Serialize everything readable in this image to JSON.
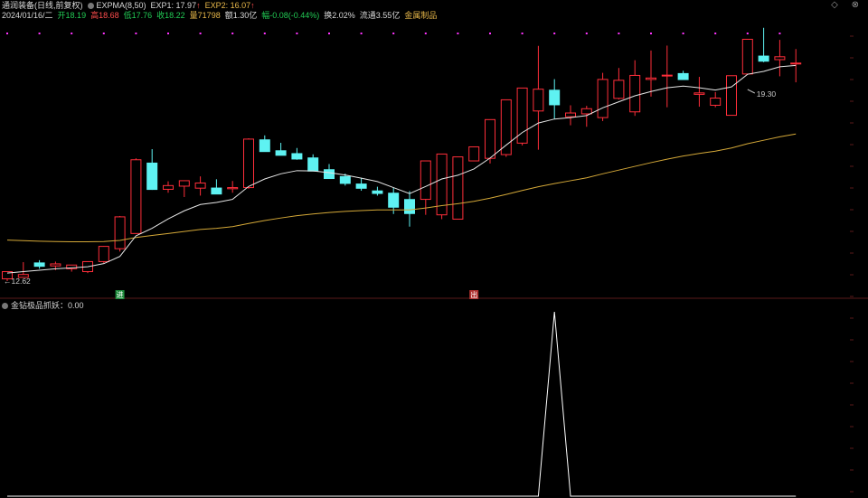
{
  "header": {
    "title": "通润装备(日线,前复权)",
    "indicator_name": "EXPMA(8,50)",
    "exp1": "EXP1: 17.97",
    "exp2": "EXP2: 16.07",
    "up_arrow": "↑",
    "date": "2024/01/16/二",
    "open": "开18.19",
    "high": "高18.68",
    "low": "低17.76",
    "close": "收18.22",
    "volume": "量71798",
    "amount": "额1.30亿",
    "change": "幅-0.08(-0.44%)",
    "turnover": "换2.02%",
    "float_cap": "流通3.55亿",
    "sector": "金属制品"
  },
  "window_controls": "◇ ⊗",
  "indicator_panel": {
    "label": "金钻极品抓妖：0.00"
  },
  "annotations": {
    "high_label": "19.30",
    "low_label": "←12.62",
    "buy_tag": "进",
    "sell_tag": "出"
  },
  "colors": {
    "up": "#ff2e3a",
    "down": "#5ef2f2",
    "exp1": "#e6e6e6",
    "exp2": "#d4a838",
    "signal": "#ffffff",
    "dot": "#ff33ff"
  },
  "chart_data": {
    "type": "candlestick",
    "x": [
      "1",
      "2",
      "3",
      "4",
      "5",
      "6",
      "7",
      "8",
      "9",
      "10",
      "11",
      "12",
      "13",
      "14",
      "15",
      "16",
      "17",
      "18",
      "19",
      "20",
      "21",
      "22",
      "23",
      "24",
      "25",
      "26",
      "27",
      "28",
      "29",
      "30",
      "31",
      "32",
      "33",
      "34",
      "35",
      "36",
      "37",
      "38",
      "39",
      "40",
      "41",
      "42",
      "43",
      "44",
      "45",
      "46",
      "47",
      "48",
      "49",
      "50"
    ],
    "open": [
      12.7,
      12.75,
      13.27,
      13.15,
      13.05,
      12.95,
      13.3,
      13.75,
      14.28,
      16.75,
      15.82,
      15.93,
      15.86,
      15.88,
      15.84,
      15.88,
      17.56,
      17.18,
      17.08,
      16.93,
      16.52,
      16.28,
      16.02,
      15.78,
      15.7,
      15.48,
      15.47,
      14.93,
      14.78,
      16.81,
      16.9,
      17.03,
      17.43,
      18.55,
      19.29,
      18.35,
      18.45,
      18.32,
      18.99,
      18.52,
      19.65,
      19.79,
      19.87,
      19.13,
      18.75,
      18.4,
      19.84,
      20.48,
      20.34,
      20.21
    ],
    "high": [
      12.92,
      13.28,
      13.35,
      13.3,
      13.12,
      13.29,
      13.84,
      14.89,
      16.9,
      17.22,
      16.1,
      16.1,
      16.27,
      16.17,
      16.11,
      17.6,
      17.7,
      17.44,
      17.26,
      17.04,
      16.7,
      16.37,
      16.22,
      15.91,
      15.88,
      15.76,
      15.6,
      15.15,
      16.78,
      17.25,
      17.1,
      18.0,
      18.8,
      20.82,
      19.66,
      18.75,
      18.73,
      19.88,
      20.05,
      20.32,
      20.66,
      20.83,
      19.95,
      19.74,
      19.21,
      19.1,
      20.9,
      21.45,
      21.03,
      20.71
    ],
    "low": [
      12.62,
      12.75,
      13.05,
      13.0,
      12.95,
      12.9,
      13.25,
      13.65,
      14.28,
      15.8,
      15.7,
      15.55,
      15.6,
      15.65,
      15.7,
      15.84,
      17.15,
      17.02,
      16.85,
      16.48,
      16.2,
      15.95,
      15.77,
      15.6,
      14.96,
      14.52,
      14.93,
      14.78,
      14.78,
      16.81,
      16.72,
      16.95,
      17.35,
      17.2,
      18.26,
      18.05,
      18.0,
      18.2,
      18.95,
      18.38,
      19.05,
      18.68,
      19.72,
      18.7,
      18.68,
      18.4,
      19.82,
      20.25,
      19.76,
      19.55
    ],
    "close": [
      12.95,
      12.85,
      13.12,
      13.22,
      13.18,
      13.3,
      13.83,
      14.86,
      16.85,
      15.8,
      15.95,
      16.12,
      16.04,
      15.64,
      15.88,
      17.57,
      17.12,
      16.99,
      16.86,
      16.44,
      16.18,
      16.01,
      15.84,
      15.66,
      15.18,
      14.96,
      16.81,
      17.05,
      16.95,
      17.3,
      18.25,
      18.94,
      19.35,
      19.31,
      18.75,
      18.48,
      18.63,
      19.65,
      19.62,
      19.79,
      19.7,
      19.8,
      19.63,
      19.18,
      19.0,
      19.78,
      21.05,
      20.27,
      20.44,
      20.22
    ],
    "exp1": [
      12.9,
      12.95,
      13.0,
      13.05,
      13.08,
      13.12,
      13.23,
      13.48,
      14.2,
      14.46,
      14.79,
      15.07,
      15.29,
      15.36,
      15.47,
      15.92,
      16.18,
      16.36,
      16.47,
      16.46,
      16.4,
      16.32,
      16.21,
      16.09,
      15.88,
      15.67,
      15.92,
      16.18,
      16.31,
      16.53,
      16.91,
      17.36,
      17.8,
      18.13,
      18.27,
      18.32,
      18.39,
      18.66,
      18.87,
      19.08,
      19.23,
      19.36,
      19.42,
      19.36,
      19.28,
      19.39,
      19.83,
      19.93,
      20.09,
      20.14
    ],
    "exp2": [
      14.05,
      14.03,
      14.01,
      14.0,
      13.99,
      13.99,
      14.0,
      14.04,
      14.14,
      14.21,
      14.28,
      14.35,
      14.42,
      14.46,
      14.52,
      14.63,
      14.73,
      14.82,
      14.9,
      14.96,
      15.01,
      15.05,
      15.08,
      15.1,
      15.1,
      15.1,
      15.17,
      15.25,
      15.32,
      15.4,
      15.51,
      15.64,
      15.78,
      15.91,
      16.02,
      16.12,
      16.22,
      16.36,
      16.49,
      16.62,
      16.75,
      16.87,
      16.98,
      17.07,
      17.15,
      17.26,
      17.41,
      17.53,
      17.65,
      17.75
    ],
    "signal": [
      0,
      0,
      0,
      0,
      0,
      0,
      0,
      0,
      0,
      0,
      0,
      0,
      0,
      0,
      0,
      0,
      0,
      0,
      0,
      0,
      0,
      0,
      0,
      0,
      0,
      0,
      0,
      0,
      0,
      0,
      0,
      0,
      0,
      0,
      1,
      0,
      0,
      0,
      0,
      0,
      0,
      0,
      0,
      0,
      0,
      0,
      0,
      0,
      0,
      0
    ],
    "ylim": [
      12.4,
      21.6
    ],
    "signal_ylim": [
      0,
      1
    ],
    "highest": 19.3,
    "lowest": 12.62
  }
}
